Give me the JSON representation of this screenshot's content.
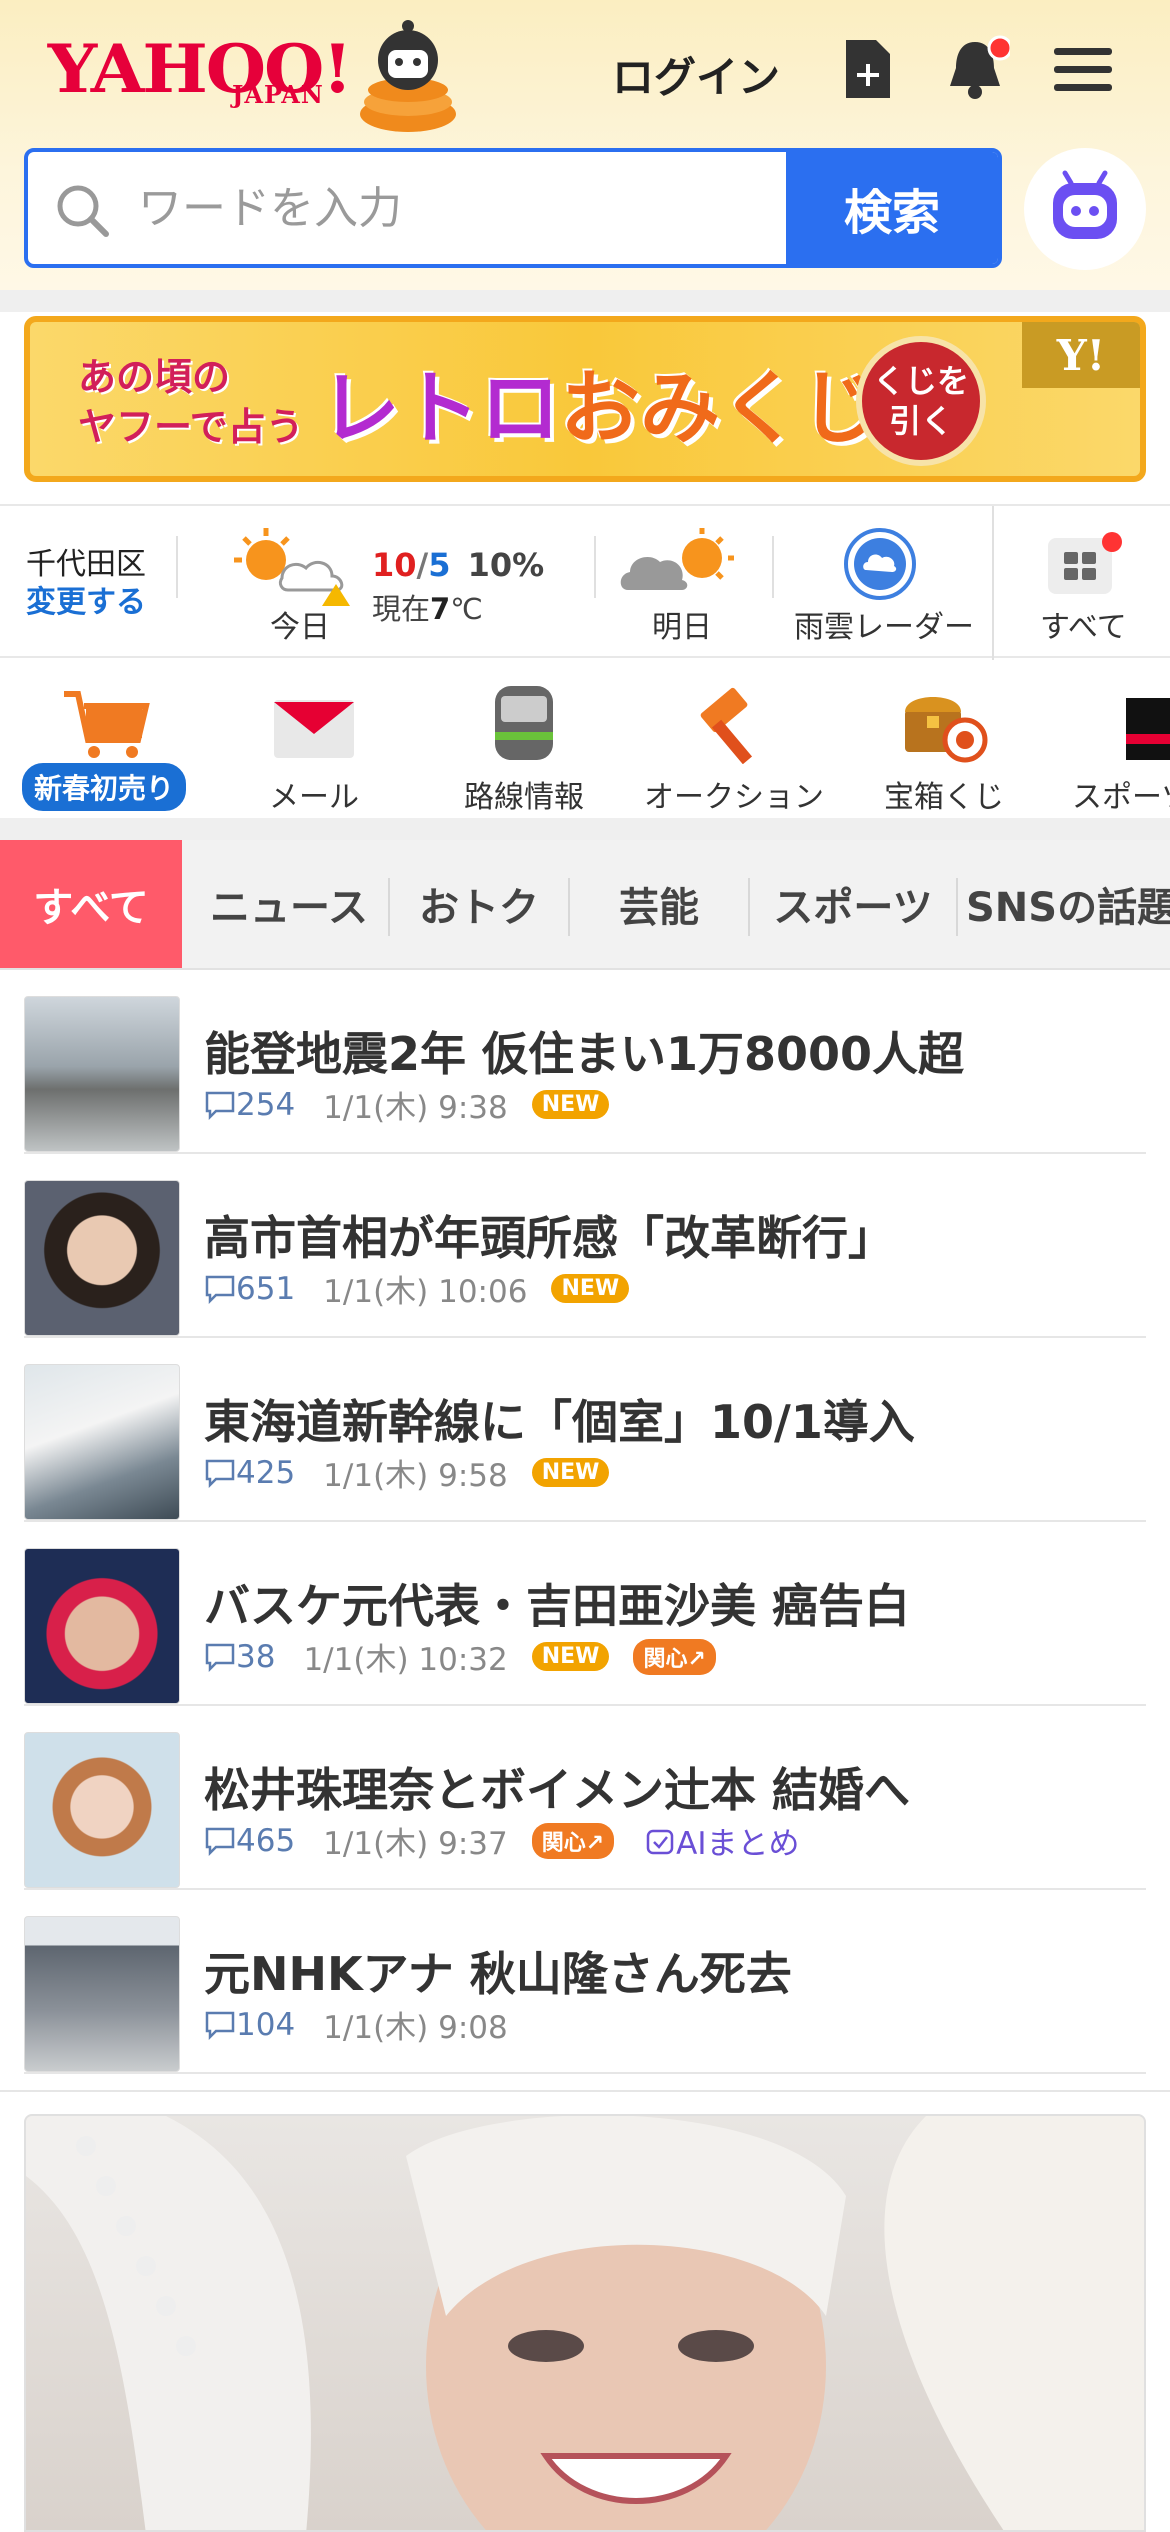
{
  "header": {
    "logo_text": "YAHOO!",
    "logo_sub": "JAPAN",
    "login_label": "ログイン",
    "icons": [
      "new-doc-icon",
      "bell-icon",
      "menu-icon"
    ]
  },
  "search": {
    "placeholder": "ワードを入力",
    "button_label": "検索"
  },
  "banner": {
    "line1": "あの頃の",
    "line2": "ヤフーで占う",
    "title_a": "レトロ",
    "title_b": "おみくじ",
    "button_line1": "くじを",
    "button_line2": "引く",
    "corner": "Y!"
  },
  "weather": {
    "location": "千代田区",
    "change_label": "変更する",
    "today_label": "今日",
    "high": "10",
    "slash": "/",
    "low": "5",
    "precip": "10%",
    "now_prefix": "現在",
    "now_temp": "7",
    "now_unit": "℃",
    "tomorrow_label": "明日",
    "radar_label": "雨雲レーダー",
    "all_label": "すべて"
  },
  "services": [
    {
      "label": "新春初売り",
      "icon": "cart-icon"
    },
    {
      "label": "メール",
      "icon": "mail-icon"
    },
    {
      "label": "路線情報",
      "icon": "train-icon"
    },
    {
      "label": "オークション",
      "icon": "gavel-icon"
    },
    {
      "label": "宝箱くじ",
      "icon": "treasure-icon"
    },
    {
      "label": "スポーツ",
      "icon": "sports-icon"
    }
  ],
  "tabs": [
    "すべて",
    "ニュース",
    "おトク",
    "芸能",
    "スポーツ",
    "SNSの話題"
  ],
  "news": [
    {
      "title": "能登地震2年 仮住まい1万8000人超",
      "comments": "254",
      "time": "1/1(木) 9:38",
      "new": "NEW"
    },
    {
      "title": "高市首相が年頭所感「改革断行」",
      "comments": "651",
      "time": "1/1(木) 10:06",
      "new": "NEW"
    },
    {
      "title": "東海道新幹線に「個室」10/1導入",
      "comments": "425",
      "time": "1/1(木) 9:58",
      "new": "NEW"
    },
    {
      "title": "バスケ元代表・吉田亜沙美 癌告白",
      "comments": "38",
      "time": "1/1(木) 10:32",
      "new": "NEW",
      "hot": "関心"
    },
    {
      "title": "松井珠理奈とボイメン辻本 結婚へ",
      "comments": "465",
      "time": "1/1(木) 9:37",
      "hot": "関心",
      "ai": "AIまとめ"
    },
    {
      "title": "元NHKアナ 秋山隆さん死去",
      "comments": "104",
      "time": "1/1(木) 9:08"
    }
  ],
  "colors": {
    "brand_red": "#e6003a",
    "search_blue": "#2b6ff0",
    "tab_active": "#ff5a6a",
    "new_badge": "#f2a300"
  }
}
